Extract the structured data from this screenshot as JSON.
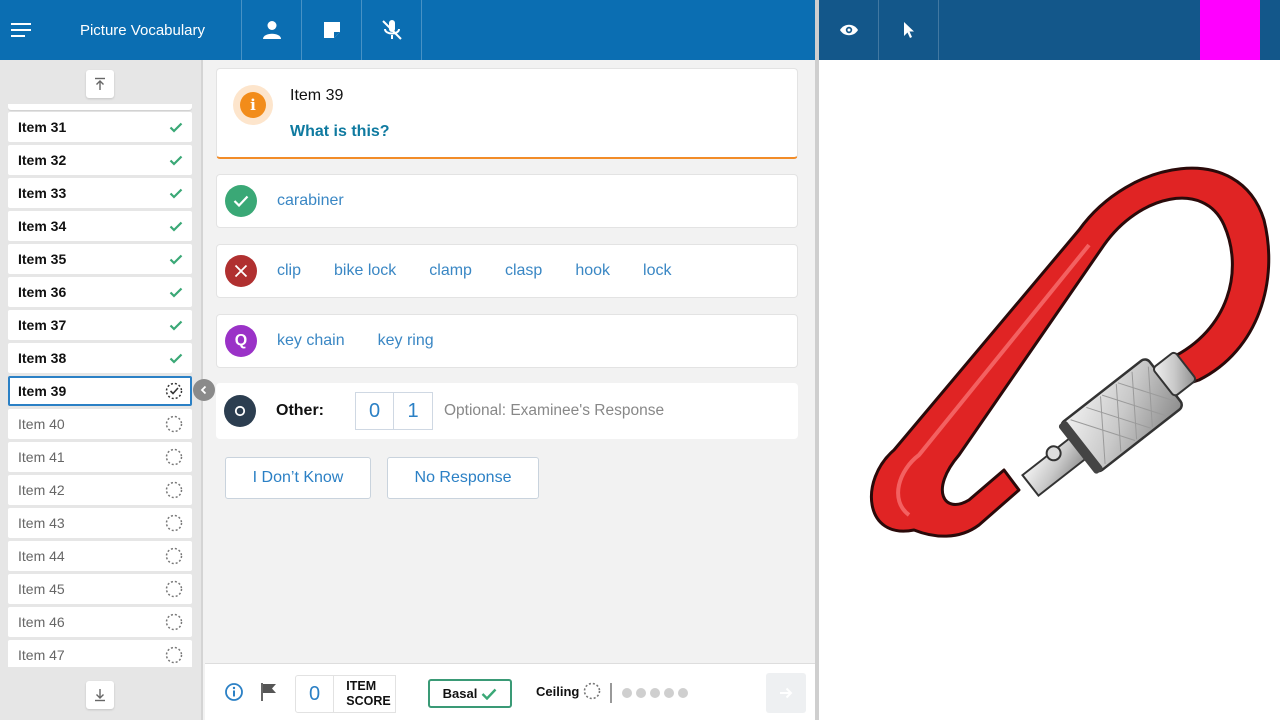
{
  "app": {
    "title": "Picture Vocabulary"
  },
  "colors": {
    "topbar_left": "#0b6eb2",
    "topbar_right": "#13578a",
    "accent": "#2b80c5",
    "correct": "#3aa876",
    "incorrect": "#b03030",
    "query": "#9a32c7",
    "other": "#2c3e50",
    "info": "#f28c1a"
  },
  "sidebar": {
    "items": [
      {
        "label": "Item 31",
        "status": "done"
      },
      {
        "label": "Item 32",
        "status": "done"
      },
      {
        "label": "Item 33",
        "status": "done"
      },
      {
        "label": "Item 34",
        "status": "done"
      },
      {
        "label": "Item 35",
        "status": "done"
      },
      {
        "label": "Item 36",
        "status": "done"
      },
      {
        "label": "Item 37",
        "status": "done"
      },
      {
        "label": "Item 38",
        "status": "done"
      },
      {
        "label": "Item 39",
        "status": "current"
      },
      {
        "label": "Item 40",
        "status": "pending"
      },
      {
        "label": "Item 41",
        "status": "pending"
      },
      {
        "label": "Item 42",
        "status": "pending"
      },
      {
        "label": "Item 43",
        "status": "pending"
      },
      {
        "label": "Item 44",
        "status": "pending"
      },
      {
        "label": "Item 45",
        "status": "pending"
      },
      {
        "label": "Item 46",
        "status": "pending"
      },
      {
        "label": "Item 47",
        "status": "pending"
      }
    ]
  },
  "prompt": {
    "item_title": "Item 39",
    "question": "What is this?",
    "info_symbol": "i"
  },
  "responses": {
    "correct": [
      "carabiner"
    ],
    "incorrect": [
      "clip",
      "bike lock",
      "clamp",
      "clasp",
      "hook",
      "lock"
    ],
    "query_icon_letter": "Q",
    "query": [
      "key chain",
      "key ring"
    ]
  },
  "other": {
    "label": "Other:",
    "score_options": [
      "0",
      "1"
    ],
    "placeholder": "Optional: Examinee's Response"
  },
  "actions": {
    "dont_know": "I Don’t Know",
    "no_response": "No Response"
  },
  "bottom": {
    "item_score_value": "0",
    "item_score_line1": "ITEM",
    "item_score_line2": "SCORE",
    "basal_label": "Basal",
    "ceiling_label": "Ceiling"
  }
}
